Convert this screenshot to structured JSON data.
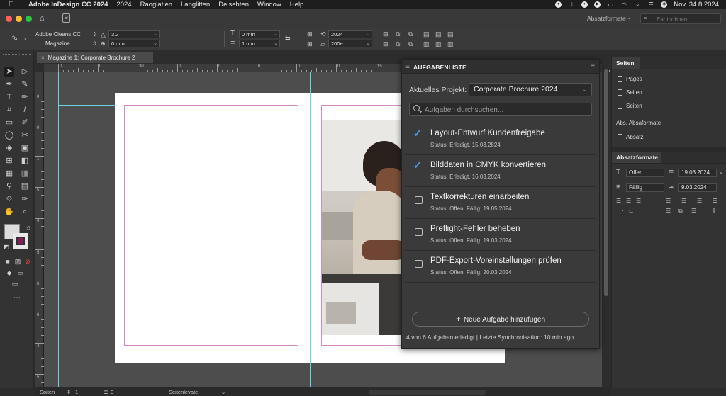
{
  "menubar": {
    "app": "Adobe InDesign CC 2024",
    "items": [
      "2024",
      "Raoglatien",
      "Langlitten",
      "Delsehten",
      "Window",
      "Help"
    ],
    "clock": "Nov. 34 8 2024"
  },
  "appbar": {
    "app_icon": "Ǝ",
    "workspace": "Absatzformate",
    "search_placeholder": "Eartinobnen"
  },
  "control": {
    "font": "Adobe Cleans CC",
    "style": "Magazine",
    "size": "3.2",
    "leading": "0 mm",
    "indent_a": "0 mm",
    "indent_b": "1 mm",
    "val_a": "2024",
    "val_b": "200e"
  },
  "document_tab": "Magazine 1: Corporate Brochure 2",
  "ruler": {
    "labels": [
      "0",
      "0",
      "30",
      "0",
      "0",
      "0",
      "0",
      "0",
      "15",
      "0",
      "0",
      "0",
      "0",
      "0"
    ]
  },
  "ruler_v": {
    "labels": [
      "0",
      "0",
      "1",
      "5",
      "5",
      "5",
      "6",
      "6",
      "4",
      "5"
    ]
  },
  "task_panel": {
    "title": "AUFGABENLISTE",
    "project_label": "Aktuelles Projekt:",
    "project_value": "Corporate Brochure 2024",
    "search_placeholder": "Aufgaben durchsuchen...",
    "tasks": [
      {
        "name": "Layout-Entwurf Kundenfreigabe",
        "status": "Status: Erledigt, 15.03.2824",
        "done": true
      },
      {
        "name": "Bilddaten in CMYK konvertieren",
        "status": "Status: Erledigt, 16.03.2024",
        "done": true
      },
      {
        "name": "Textkorrekturen einarbeiten",
        "status": "Status: Offen, Fällig: 19.05.2024",
        "done": false
      },
      {
        "name": "Preflight-Fehler beheben",
        "status": "Status: Offen, Fällig: 19.03.2024",
        "done": false
      },
      {
        "name": "PDF-Export-Voreinstellungen prüfen",
        "status": "Status: Offen, Fällig: 20.03.2024",
        "done": false
      }
    ],
    "add_button": "Neue Aufgabe hinzufügen",
    "footer": "4 von 6 Aufgaben erledigt  |  Letzte Synchronisation: 10 min ago"
  },
  "right_panel": {
    "tab1": "Seiten",
    "pages": [
      "Pages",
      "Seiten",
      "Seiten"
    ],
    "abs_label": "Abs. Absaformate",
    "abs_item": "Absatz",
    "tab2": "Absatzformate",
    "field_a": "Offen",
    "field_b": "19.03.2024",
    "field_c": "Fällig",
    "field_d": "9.03.2024"
  },
  "statusbar": {
    "pages_label": "Soiten",
    "page_num": "1",
    "errors": "0",
    "mode": "Seitenlevate"
  },
  "colors": {
    "accent_blue": "#4f9cf0",
    "margin_guide": "#d489c9",
    "column_guide": "#6fd1e4",
    "stroke_swatch_inner": "#8a1a5a"
  }
}
